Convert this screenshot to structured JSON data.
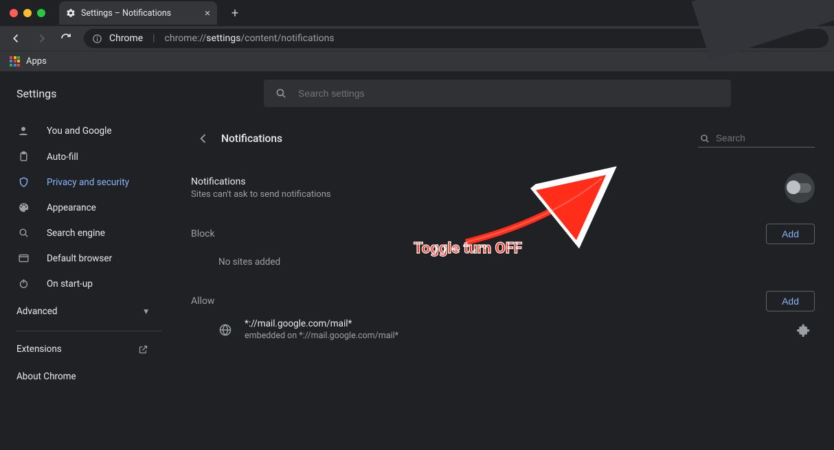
{
  "tab": {
    "title": "Settings – Notifications"
  },
  "omnibox": {
    "origin_label": "Chrome",
    "url_prefix": "chrome://",
    "url_bold": "settings",
    "url_rest": "/content/notifications"
  },
  "bookmarks": {
    "apps_label": "Apps"
  },
  "header": {
    "title": "Settings",
    "search_placeholder": "Search settings"
  },
  "sidebar": {
    "items": [
      {
        "label": "You and Google"
      },
      {
        "label": "Auto-fill"
      },
      {
        "label": "Privacy and security"
      },
      {
        "label": "Appearance"
      },
      {
        "label": "Search engine"
      },
      {
        "label": "Default browser"
      },
      {
        "label": "On start-up"
      }
    ],
    "advanced_label": "Advanced",
    "extensions_label": "Extensions",
    "about_label": "About Chrome"
  },
  "main": {
    "title": "Notifications",
    "search_placeholder": "Search",
    "notif_title": "Notifications",
    "notif_sub": "Sites can't ask to send notifications",
    "block_label": "Block",
    "block_add": "Add",
    "block_empty": "No sites added",
    "allow_label": "Allow",
    "allow_add": "Add",
    "allow_site_pattern": "*://mail.google.com/mail*",
    "allow_site_embed": "embedded on *://mail.google.com/mail*"
  },
  "annotation": {
    "text": "Toggle turn OFF"
  }
}
